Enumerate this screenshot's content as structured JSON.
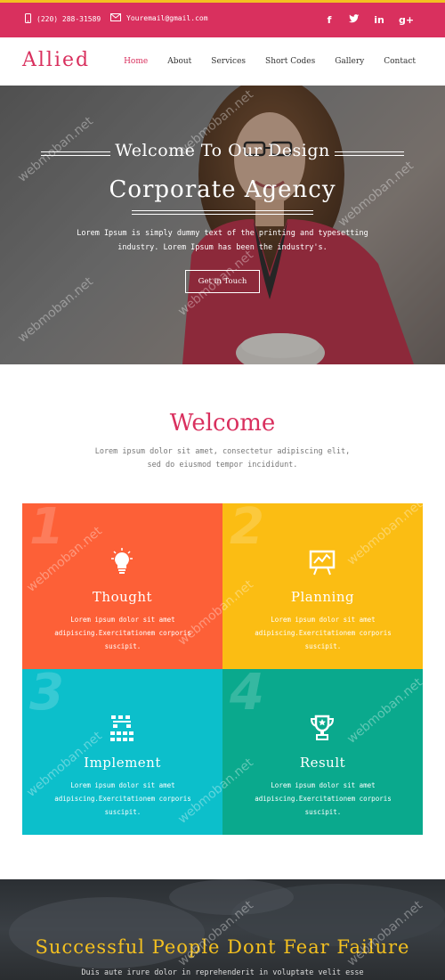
{
  "topbar": {
    "phone": "(220) 288-31589",
    "email": "Youremail@gmail.com",
    "socials": [
      "f",
      "t",
      "in",
      "g+"
    ]
  },
  "nav": {
    "logo": "Allied",
    "menu": [
      "Home",
      "About",
      "Services",
      "Short Codes",
      "Gallery",
      "Contact"
    ],
    "active": "Home"
  },
  "hero": {
    "title_line1": "Welcome To Our Design",
    "title_line2": "Corporate Agency",
    "description": "Lorem Ipsum is simply dummy text of the printing and typesetting industry. Lorem Ipsum has been the industry's.",
    "cta": "Get in Touch"
  },
  "welcome": {
    "title": "Welcome",
    "description": "Lorem ipsum dolor sit amet, consectetur adipiscing elit, sed do eiusmod tempor incididunt."
  },
  "features": [
    {
      "number": "1",
      "title": "Thought",
      "icon": "lightbulb-icon",
      "color": "#fd6037",
      "text": "Lorem ipsum dolor sit amet adipiscing.Exercitationem corporis suscipit."
    },
    {
      "number": "2",
      "title": "Planning",
      "icon": "presentation-board-icon",
      "color": "#fbbd13",
      "text": "Lorem ipsum dolor sit amet adipiscing.Exercitationem corporis suscipit."
    },
    {
      "number": "3",
      "title": "Implement",
      "icon": "org-chart-icon",
      "color": "#0cbfcb",
      "text": "Lorem ipsum dolor sit amet adipiscing.Exercitationem corporis suscipit."
    },
    {
      "number": "4",
      "title": "Result",
      "icon": "trophy-icon",
      "color": "#0aa98d",
      "text": "Lorem ipsum dolor sit amet adipiscing.Exercitationem corporis suscipit."
    }
  ],
  "banner": {
    "title": "Successful People Dont Fear Failure",
    "subtitle": "Duis aute irure dolor in reprehenderit in voluptate velit esse"
  },
  "watermark": "webmoban.net"
}
